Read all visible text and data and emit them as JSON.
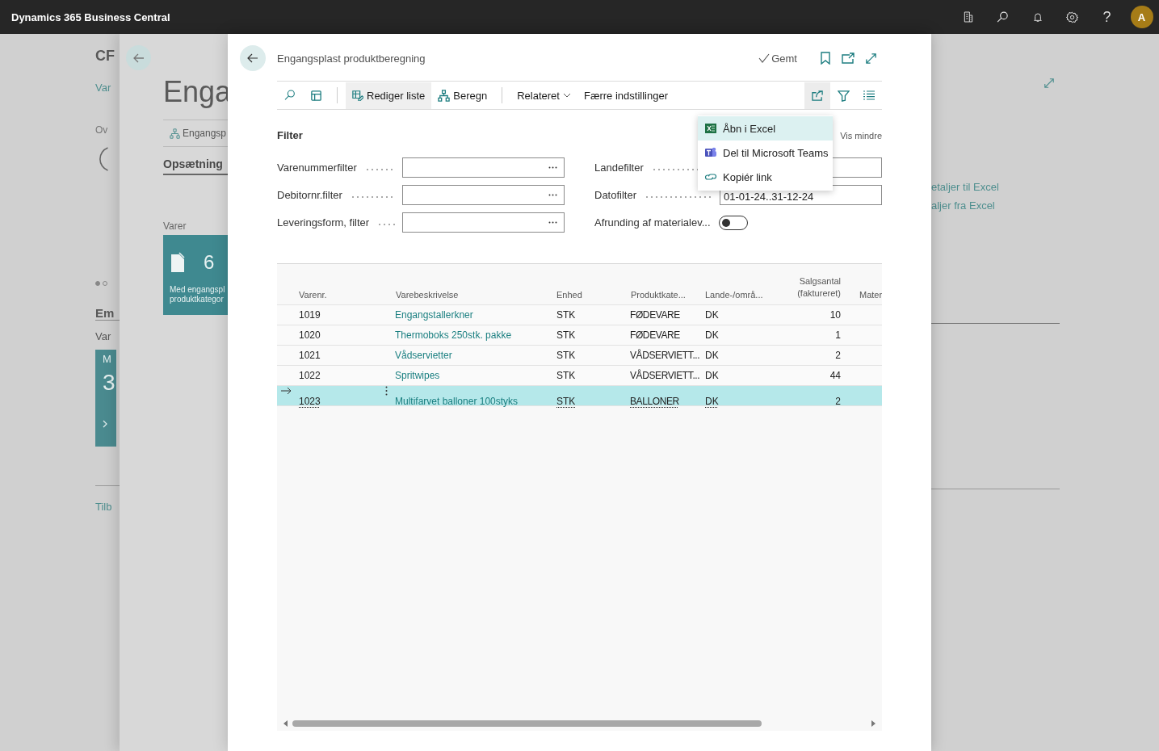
{
  "app_bar": {
    "title": "Dynamics 365 Business Central",
    "help": "?",
    "avatar": "A"
  },
  "background_page": {
    "title": "CF",
    "link": "Var",
    "section_label": "Ov",
    "pager": [
      {
        "selected": true
      },
      {
        "selected": false
      }
    ],
    "section_title": "Em",
    "group_label": "Var",
    "tile": {
      "label": "M",
      "value": "3"
    },
    "footer_link": "Tilb",
    "actions": [
      "etaljer til Excel",
      "aljer fra Excel"
    ]
  },
  "middle_page": {
    "title": "Enga",
    "action": "Engangsp",
    "tab": "Opsætning",
    "group_label": "Varer",
    "tile": {
      "value": "6",
      "caption": [
        "Med engangspl",
        "produktkategor"
      ]
    }
  },
  "dialog": {
    "title": "Engangsplast produktberegning",
    "save_state": "Gemt",
    "toolbar": {
      "edit_list": {
        "label": "Rediger liste",
        "selected": true
      },
      "calculate": "Beregn",
      "related": "Relateret",
      "fewer_options": "Færre indstillinger"
    },
    "share_menu": {
      "expanded": true,
      "items": [
        {
          "label": "Åbn i Excel",
          "selected": true
        },
        {
          "label": "Del til Microsoft Teams",
          "selected": false
        },
        {
          "label": "Kopiér link",
          "selected": false
        }
      ]
    },
    "filter": {
      "title": "Filter",
      "toggle_link": "Vis mindre",
      "fields_left": [
        {
          "label": "Varenummerfilter",
          "kind": "lookup"
        },
        {
          "label": "Debitornr.filter",
          "kind": "lookup"
        },
        {
          "label": "Leveringsform, filter",
          "kind": "lookup"
        }
      ],
      "fields_right": [
        {
          "label": "Landefilter",
          "kind": "text"
        },
        {
          "label": "Datofilter",
          "kind": "text",
          "value": "01-01-24..31-12-24"
        },
        {
          "label": "Afrunding af materialev...",
          "kind": "toggle",
          "on": false
        }
      ]
    },
    "table": {
      "columns": [
        "Varenr.",
        "Varebeskrivelse",
        "Enhed",
        "Produktkate...",
        "Lande-/områ...",
        "Salgsantal (faktureret)",
        "Mater"
      ],
      "rows": [
        {
          "cells": [
            "1019",
            "Engangstallerkner",
            "STK",
            "FØDEVARE",
            "DK",
            "10"
          ],
          "selected": false
        },
        {
          "cells": [
            "1020",
            "Thermoboks 250stk. pakke",
            "STK",
            "FØDEVARE",
            "DK",
            "1"
          ],
          "selected": false
        },
        {
          "cells": [
            "1021",
            "Vådservietter",
            "STK",
            "VÅDSERVIETT...",
            "DK",
            "2"
          ],
          "selected": false
        },
        {
          "cells": [
            "1022",
            "Spritwipes",
            "STK",
            "VÅDSERVIETT...",
            "DK",
            "44"
          ],
          "selected": false
        },
        {
          "cells": [
            "1023",
            "Multifarvet balloner 100styks",
            "STK",
            "BALLONER",
            "DK",
            "2"
          ],
          "selected": true
        }
      ]
    }
  }
}
